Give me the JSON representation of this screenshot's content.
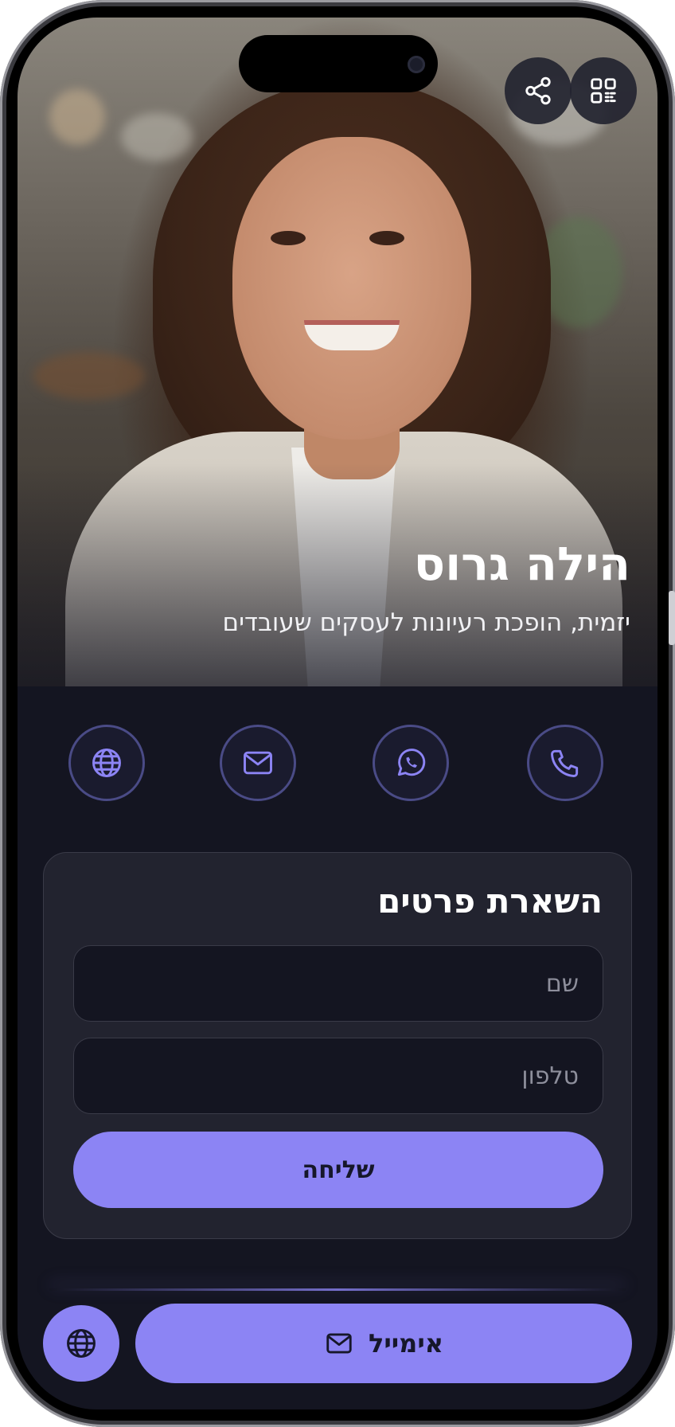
{
  "profile": {
    "name": "הילה גרוס",
    "subtitle": "יזמית, הופכת רעיונות לעסקים שעובדים"
  },
  "top_actions": [
    {
      "icon": "qr-code-icon",
      "label": ""
    },
    {
      "icon": "share-icon",
      "label": ""
    }
  ],
  "contact_actions": [
    {
      "icon": "phone-icon"
    },
    {
      "icon": "whatsapp-icon"
    },
    {
      "icon": "mail-icon"
    },
    {
      "icon": "globe-icon"
    }
  ],
  "lead_form": {
    "title": "השארת פרטים",
    "name_placeholder": "שם",
    "phone_placeholder": "טלפון",
    "submit_label": "שליחה"
  },
  "bottom_bar": {
    "email_label": "אימייל",
    "email_icon": "mail-icon",
    "globe_icon": "globe-icon"
  },
  "colors": {
    "accent": "#8c84f4",
    "background": "#141521",
    "card": "#22232f",
    "icon_ring": "#4a4b86"
  }
}
